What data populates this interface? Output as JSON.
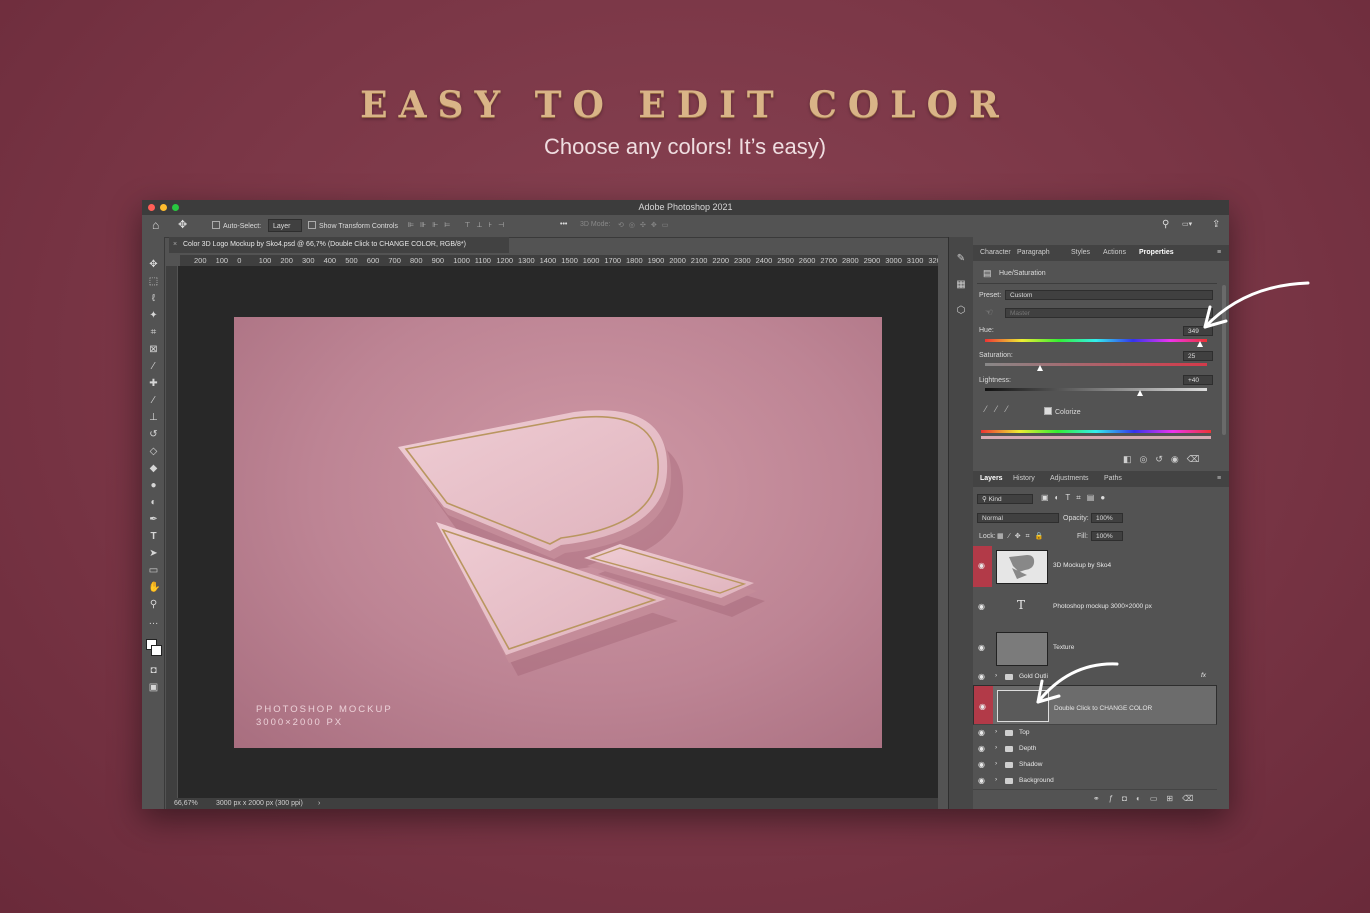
{
  "hero": {
    "headline": "EASY TO EDIT COLOR",
    "subline": "Choose any colors! It’s easy)"
  },
  "app": {
    "title": "Adobe Photoshop 2021"
  },
  "options_bar": {
    "auto_select_label": "Auto-Select:",
    "auto_select_value": "Layer",
    "show_transform_label": "Show Transform Controls",
    "mode_3d_label": "3D Mode:"
  },
  "document": {
    "tab_title": "Color 3D Logo Mockup by Sko4.psd @ 66,7% (Double Click to CHANGE COLOR, RGB/8*)",
    "ruler_ticks": [
      "200",
      "100",
      "0",
      "100",
      "200",
      "300",
      "400",
      "500",
      "600",
      "700",
      "800",
      "900",
      "1000",
      "1100",
      "1200",
      "1300",
      "1400",
      "1500",
      "1600",
      "1700",
      "1800",
      "1900",
      "2000",
      "2100",
      "2200",
      "2300",
      "2400",
      "2500",
      "2600",
      "2700",
      "2800",
      "2900",
      "3000",
      "3100",
      "3200"
    ],
    "mockup_caption_line1": "PHOTOSHOP MOCKUP",
    "mockup_caption_line2": "3000×2000 PX",
    "status_zoom": "66,67%",
    "status_info": "3000 px x 2000 px (300 ppi)"
  },
  "properties_panel": {
    "tabs": [
      "Character",
      "Paragraph",
      "Styles",
      "Actions",
      "Properties"
    ],
    "active_tab": "Properties",
    "adjustment_name": "Hue/Saturation",
    "preset_label": "Preset:",
    "preset_value": "Custom",
    "channel_value": "Master",
    "hue_label": "Hue:",
    "hue_value": "349",
    "hue_fraction": 0.97,
    "saturation_label": "Saturation:",
    "saturation_value": "25",
    "saturation_fraction": 0.25,
    "lightness_label": "Lightness:",
    "lightness_value": "+40",
    "lightness_fraction": 0.7,
    "colorize_label": "Colorize"
  },
  "layers_panel": {
    "tabs": [
      "Layers",
      "History",
      "Adjustments",
      "Paths"
    ],
    "active_tab": "Layers",
    "filter_kind": "Kind",
    "blend_mode": "Normal",
    "opacity_label": "Opacity:",
    "opacity_value": "100%",
    "lock_label": "Lock:",
    "fill_label": "Fill:",
    "fill_value": "100%",
    "layers": [
      {
        "name": "3D Mockup by Sko4",
        "type": "smart"
      },
      {
        "name": "Photoshop mockup 3000×2000 px",
        "type": "text"
      },
      {
        "name": "Texture",
        "type": "image"
      },
      {
        "name": "Gold Outli",
        "type": "folder"
      },
      {
        "name": "Double Click to CHANGE COLOR",
        "type": "smart-selected"
      },
      {
        "name": "Top",
        "type": "folder"
      },
      {
        "name": "Depth",
        "type": "folder"
      },
      {
        "name": "Shadow",
        "type": "folder"
      },
      {
        "name": "Background",
        "type": "folder"
      }
    ]
  },
  "colors": {
    "background": "#7a3646",
    "headline_gold": "#d9b487",
    "accent_red": "#b23a48",
    "shape_fill": "#e9c3cb",
    "gold_line": "#b99660"
  }
}
